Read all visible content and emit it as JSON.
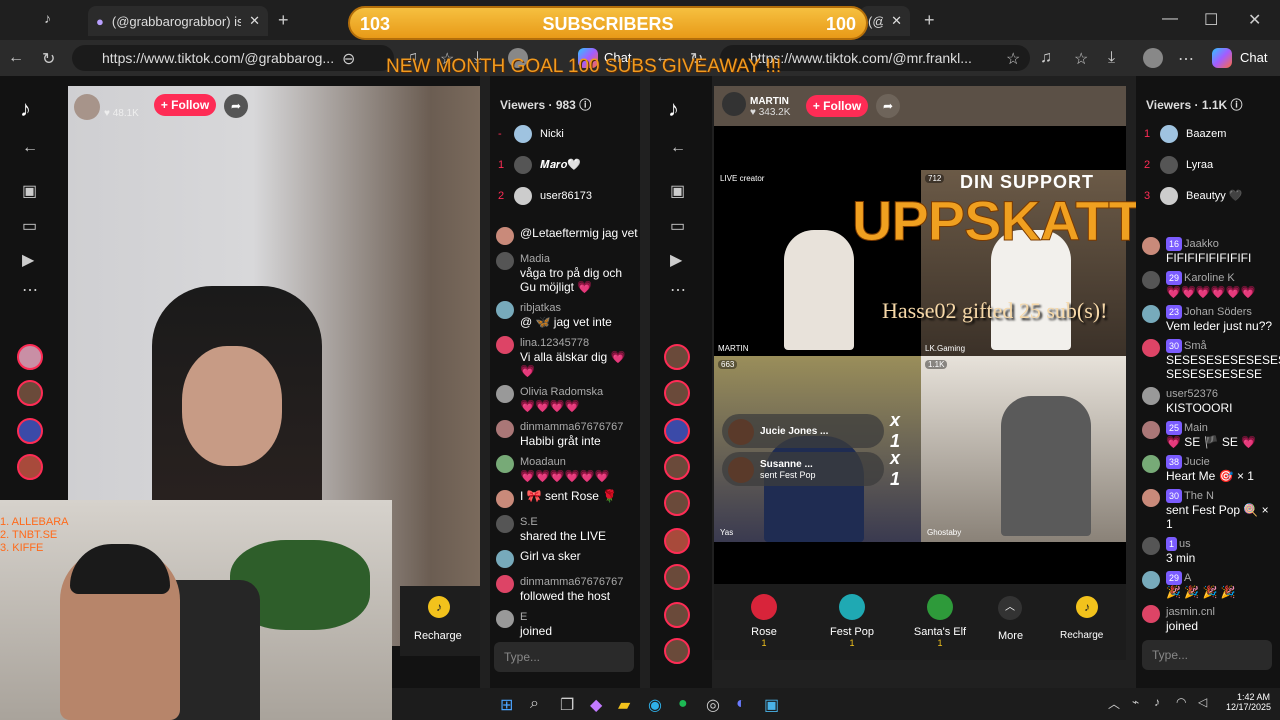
{
  "overlay": {
    "left_count": "103",
    "title": "SUBSCRIBERS",
    "right_count": "100",
    "goal": "NEW MONTH GOAL 100 SUBS GIVEAWAY !!!",
    "top_list": [
      "1. ALLEBARA",
      "2. TNBT.SE",
      "3. KIFFE"
    ]
  },
  "left_browser": {
    "tab_title": "(@grabbarograbbor) is LIVE",
    "url": "https://www.tiktok.com/@grabbarog...",
    "chat_label": "Chat"
  },
  "right_browser": {
    "tab_title": "(@mr.franklin) is LIVE",
    "url": "https://www.tiktok.com/@mr.frankl...",
    "chat_label": "Chat"
  },
  "left_stream": {
    "host_likes": "48.1K",
    "follow": "+ Follow",
    "recharge": "Recharge",
    "viewers_label": "Viewers",
    "viewers_count": "983",
    "top_viewers": [
      {
        "rank": "-",
        "name": "Nicki"
      },
      {
        "rank": "1",
        "name": "𝑴𝒂𝒓𝒐🤍"
      },
      {
        "rank": "2",
        "name": "user86173"
      }
    ],
    "chat": [
      {
        "name": "",
        "msg": "@Letaeftermig jag vet"
      },
      {
        "name": "Madia",
        "msg": "våga tro på dig och Gu möjligt 💗"
      },
      {
        "name": "ribjatkas",
        "msg": "@ 🦋 jag vet inte"
      },
      {
        "name": "lina.12345778",
        "msg": "Vi alla älskar dig 💗💗"
      },
      {
        "name": "Olivia Radomska",
        "msg": "💗💗💗💗"
      },
      {
        "name": "dinmamma67676767",
        "msg": "Habibi gråt inte"
      },
      {
        "name": "Moadaun",
        "msg": "💗💗💗💗💗💗"
      },
      {
        "name": "",
        "msg": "I 🎀 sent Rose 🌹"
      },
      {
        "name": "S.E",
        "msg": "shared the LIVE"
      },
      {
        "name": "",
        "msg": "Girl va sker"
      },
      {
        "name": "dinmamma67676767",
        "msg": "followed the host"
      },
      {
        "name": "E",
        "msg": "joined"
      }
    ],
    "type_placeholder": "Type..."
  },
  "right_stream": {
    "host_name": "MARTIN",
    "host_likes": "343.2K",
    "follow": "+ Follow",
    "viewers_label": "Viewers",
    "viewers_count": "1.1K",
    "top_viewers": [
      {
        "rank": "1",
        "name": "Baazem"
      },
      {
        "rank": "2",
        "name": "Lyraa"
      },
      {
        "rank": "3",
        "name": "Beautyy 🖤"
      }
    ],
    "banner": "DIN SUPPORT",
    "banner_big": "UPPSKATTAS",
    "gift_line": "Hasse02 gifted 25 sub(s)!",
    "grid": {
      "tl_label": "LIVE creator",
      "tl_name": "MARTIN",
      "tr_count": "712",
      "tr_name": "LK.Gaming",
      "bl_count": "663",
      "bl_name": "Yas",
      "br_count": "1.1K",
      "br_name": "Ghostaby"
    },
    "gift_popups": [
      {
        "name": "Jucie Jones ...",
        "sub": "",
        "count": "x 1"
      },
      {
        "name": "Susanne ...",
        "sub": "sent Fest Pop",
        "count": "x 1"
      }
    ],
    "gifts": [
      {
        "name": "Rose",
        "price": "1"
      },
      {
        "name": "Fest Pop",
        "price": "1"
      },
      {
        "name": "Santa's Elf",
        "price": "1"
      }
    ],
    "more": "More",
    "recharge": "Recharge",
    "chat": [
      {
        "name": "Jaakko",
        "badge": "16",
        "msg": "FIFIFIFIFIFIFIFI"
      },
      {
        "name": "Karoline K",
        "badge": "29",
        "msg": "💗💗💗💗💗💗"
      },
      {
        "name": "Johan Söders",
        "badge": "23",
        "msg": "Vem leder just nu??"
      },
      {
        "name": "Små",
        "badge": "30",
        "msg": "SESESESESESESESESESESE SESESESESESE"
      },
      {
        "name": "user52376",
        "badge": "",
        "msg": "KISTOOORI"
      },
      {
        "name": "Main",
        "badge": "25",
        "msg": "💗 SE 🏴 SE 💗"
      },
      {
        "name": "Jucie",
        "badge": "38",
        "msg": "Heart Me 🎯 × 1"
      },
      {
        "name": "The N",
        "badge": "30",
        "msg": "sent Fest Pop 🍭 × 1"
      },
      {
        "name": "us",
        "badge": "1",
        "msg": "3 min"
      },
      {
        "name": "A",
        "badge": "29",
        "msg": "🎉 🎉 🎉 🎉"
      },
      {
        "name": "jasmin.cnl",
        "badge": "",
        "msg": "joined"
      }
    ],
    "type_placeholder": "Type..."
  },
  "clock": {
    "time": "1:42 AM",
    "date": "12/17/2025"
  }
}
